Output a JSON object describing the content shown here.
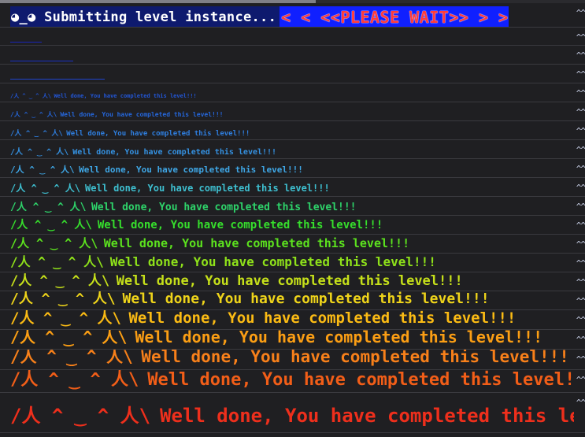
{
  "status_bar": {
    "progress_fraction": 0.54
  },
  "header": {
    "left_text": "◕_◕ Submitting level instance...",
    "right_text": "<  < <<PLEASE WAIT>> >  >"
  },
  "caret_text": "^^",
  "messages": [
    {
      "face": "",
      "text": "",
      "color": "#1a24b8"
    },
    {
      "face": "",
      "text": "",
      "color": "#1a30c4"
    },
    {
      "face": "",
      "text": "",
      "color": "#1f45cf"
    },
    {
      "face": "/人 ^ ‿ ^ 人\\",
      "text": "Well done, You have completed this level!!!",
      "color": "#2256d6"
    },
    {
      "face": "/人 ^ ‿ ^ 人\\",
      "text": "Well done, You have completed this level!!!",
      "color": "#2567dc"
    },
    {
      "face": "/人 ^ ‿ ^ 人\\",
      "text": "Well done, You have completed this level!!!",
      "color": "#2f7fe0"
    },
    {
      "face": "/人 ^ ‿ ^ 人\\",
      "text": "Well done, You have completed this level!!!",
      "color": "#3592e2"
    },
    {
      "face": "/人 ^ ‿ ^ 人\\",
      "text": "Well done, You have completed this level!!!",
      "color": "#3fa7e6"
    },
    {
      "face": "/人 ^ ‿ ^ 人\\",
      "text": "Well done, You have completed this level!!!",
      "color": "#3ebfd0"
    },
    {
      "face": "/人 ^ ‿ ^ 人\\",
      "text": "Well done, You have completed this level!!!",
      "color": "#2ed36a"
    },
    {
      "face": "/人 ^ ‿ ^ 人\\",
      "text": "Well done, You have completed this level!!!",
      "color": "#36df2c"
    },
    {
      "face": "/人 ^ ‿ ^ 人\\",
      "text": "Well done, You have completed this level!!!",
      "color": "#5ce21e"
    },
    {
      "face": "/人 ^ ‿ ^ 人\\",
      "text": "Well done, You have completed this level!!!",
      "color": "#8fe21a"
    },
    {
      "face": "/人 ^ ‿ ^ 人\\",
      "text": "Well done, You have completed this level!!!",
      "color": "#c6e01a"
    },
    {
      "face": "/人 ^ ‿ ^ 人\\",
      "text": "Well done, You have completed this level!!!",
      "color": "#efd41a"
    },
    {
      "face": "/人 ^ ‿ ^ 人\\",
      "text": "Well done, You have completed this level!!!",
      "color": "#fbbb14"
    },
    {
      "face": "/人 ^ ‿ ^ 人\\",
      "text": "Well done, You have completed this level!!!",
      "color": "#fb9e14"
    },
    {
      "face": "/人 ^ ‿ ^ 人\\",
      "text": "Well done, You have completed this level!!!",
      "color": "#f8801a"
    },
    {
      "face": "/人 ^ ‿ ^ 人\\",
      "text": "Well done, You have completed this level!!!",
      "color": "#f25e18"
    },
    {
      "face": "/人 ^ ‿ ^ 人\\",
      "text": "Well done, You have completed this level!!!",
      "color": "#ee2f1c"
    }
  ]
}
